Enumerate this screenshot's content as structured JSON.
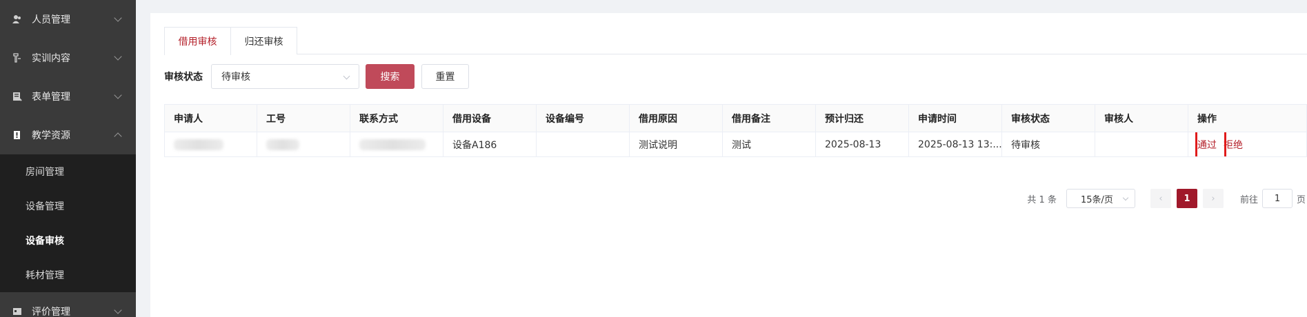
{
  "sidebar": {
    "items": [
      {
        "label": "人员管理",
        "icon": "person-icon"
      },
      {
        "label": "实训内容",
        "icon": "training-icon"
      },
      {
        "label": "表单管理",
        "icon": "form-icon"
      },
      {
        "label": "教学资源",
        "icon": "book-icon"
      },
      {
        "label": "评价管理",
        "icon": "evaluation-icon"
      }
    ],
    "submenu": [
      {
        "label": "房间管理"
      },
      {
        "label": "设备管理"
      },
      {
        "label": "设备审核"
      },
      {
        "label": "耗材管理"
      }
    ]
  },
  "tabs": [
    {
      "label": "借用审核"
    },
    {
      "label": "归还审核"
    }
  ],
  "filter": {
    "label": "审核状态",
    "select_value": "待审核",
    "search_label": "搜索",
    "reset_label": "重置"
  },
  "table": {
    "headers": [
      "申请人",
      "工号",
      "联系方式",
      "借用设备",
      "设备编号",
      "借用原因",
      "借用备注",
      "预计归还",
      "申请时间",
      "审核状态",
      "审核人",
      "操作"
    ],
    "rows": [
      {
        "applicant": "",
        "employee_id": "",
        "contact": "",
        "device": "设备A186",
        "device_no": "",
        "reason": "测试说明",
        "remark": "测试",
        "expected_return": "2025-08-13",
        "apply_time": "2025-08-13 13:...",
        "status": "待审核",
        "reviewer": "",
        "approve_label": "通过",
        "reject_label": "拒绝"
      }
    ]
  },
  "pagination": {
    "total_text": "共 1 条",
    "page_size": "15条/页",
    "current_page": "1",
    "goto_label": "前往",
    "goto_value": "1",
    "goto_suffix": "页"
  },
  "colors": {
    "accent": "#b4202a",
    "sidebar_bg": "#3a3a3a",
    "submenu_bg": "#1f1f1f"
  }
}
